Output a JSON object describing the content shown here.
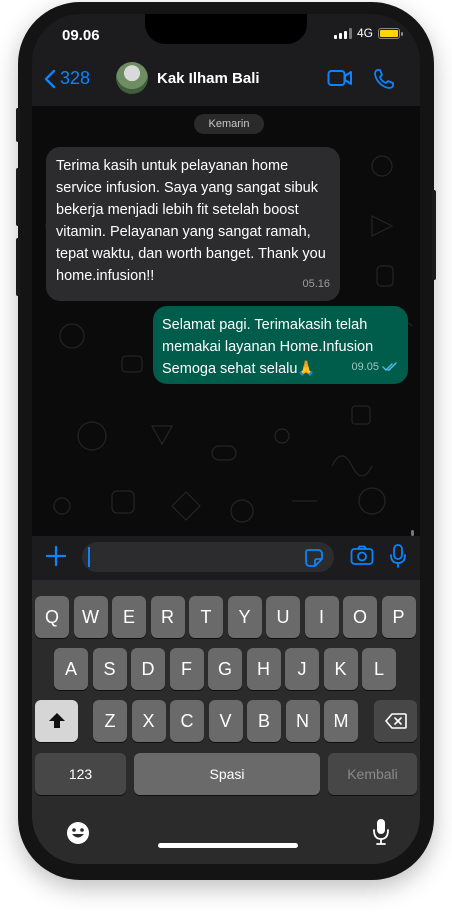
{
  "status": {
    "time": "09.06",
    "network": "4G"
  },
  "header": {
    "back_count": "328",
    "contact_name": "Kak Ilham Bali",
    "video_icon": "video-camera-icon",
    "call_icon": "phone-icon"
  },
  "chat": {
    "date_label": "Kemarin",
    "messages": [
      {
        "direction": "incoming",
        "text": "Terima kasih untuk pelayanan home service infusion. Saya yang sangat sibuk bekerja menjadi lebih fit setelah boost vitamin. Pelayanan yang sangat ramah, tepat waktu, dan worth banget. Thank you home.infusion!!",
        "time": "05.16"
      },
      {
        "direction": "outgoing",
        "text": "Selamat pagi. Terimakasih telah memakai layanan Home.Infusion Semoga sehat selalu🙏",
        "time": "09.05",
        "read": true
      }
    ]
  },
  "input": {
    "value": "",
    "placeholder": ""
  },
  "keyboard": {
    "row1": [
      "Q",
      "W",
      "E",
      "R",
      "T",
      "Y",
      "U",
      "I",
      "O",
      "P"
    ],
    "row2": [
      "A",
      "S",
      "D",
      "F",
      "G",
      "H",
      "J",
      "K",
      "L"
    ],
    "row3": [
      "Z",
      "X",
      "C",
      "V",
      "B",
      "N",
      "M"
    ],
    "numbers_label": "123",
    "space_label": "Spasi",
    "return_label": "Kembali"
  },
  "colors": {
    "accent": "#0a84ff",
    "outgoing_bubble": "#005c4b",
    "incoming_bubble": "#2c2c2e",
    "battery": "#ffd60a"
  }
}
